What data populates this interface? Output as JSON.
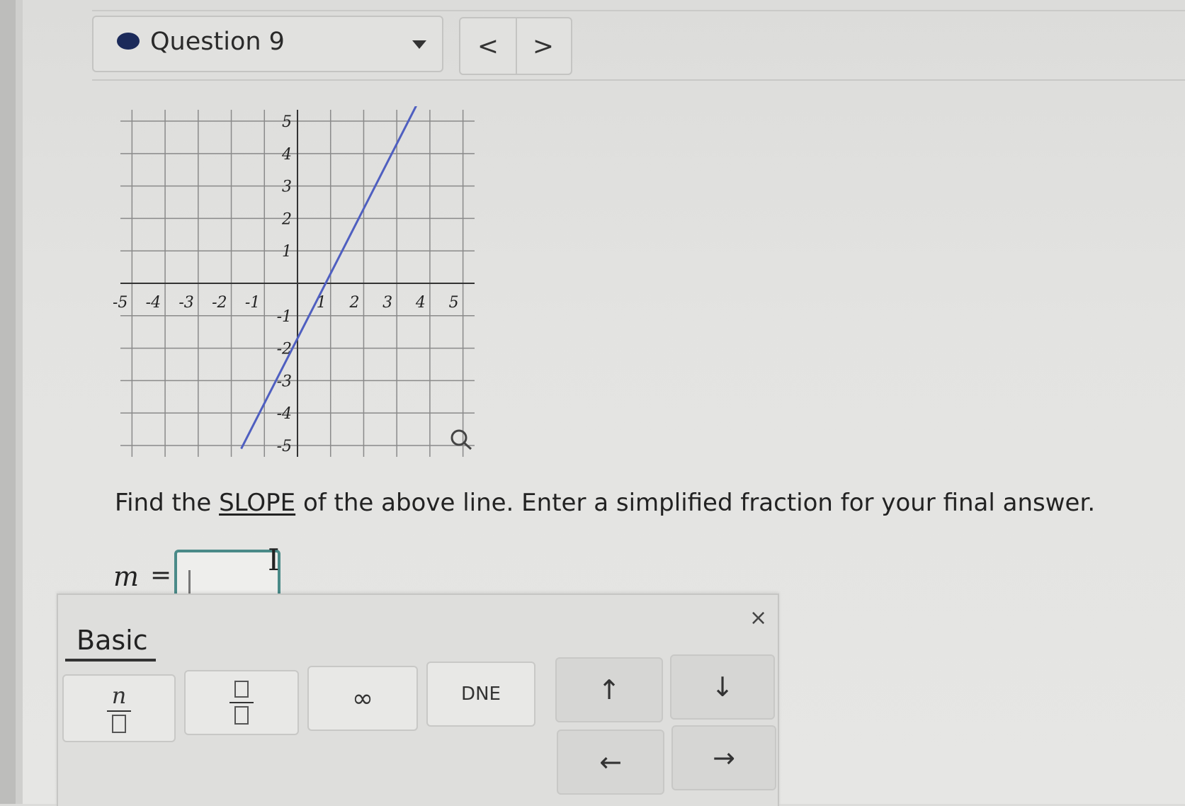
{
  "question": {
    "label": "Question 9",
    "prev": "<",
    "next": ">"
  },
  "chart_data": {
    "type": "line",
    "xlim": [
      -5,
      5
    ],
    "ylim": [
      -5,
      5
    ],
    "grid": true,
    "xticks": [
      "-5",
      "-4",
      "-3",
      "-2",
      "-1",
      "1",
      "2",
      "3",
      "4",
      "5"
    ],
    "yticks": [
      "5",
      "4",
      "3",
      "2",
      "1",
      "-1",
      "-2",
      "-3",
      "-4",
      "-5"
    ],
    "series": [
      {
        "x": [
          -1.7,
          3.6
        ],
        "y": [
          -5.1,
          5.5
        ],
        "color": "#4f5fc0"
      }
    ]
  },
  "prompt": {
    "before": "Find the ",
    "emphasis": "SLOPE",
    "after": " of the above line. Enter a simplified fraction for your final answer."
  },
  "answer": {
    "variable": "m",
    "equals": "=",
    "value": ""
  },
  "keypad": {
    "tab": "Basic",
    "close": "×",
    "fraction_num": "n",
    "infinity": "∞",
    "dne": "DNE",
    "up": "↑",
    "down": "↓",
    "left": "←",
    "right": "→"
  }
}
